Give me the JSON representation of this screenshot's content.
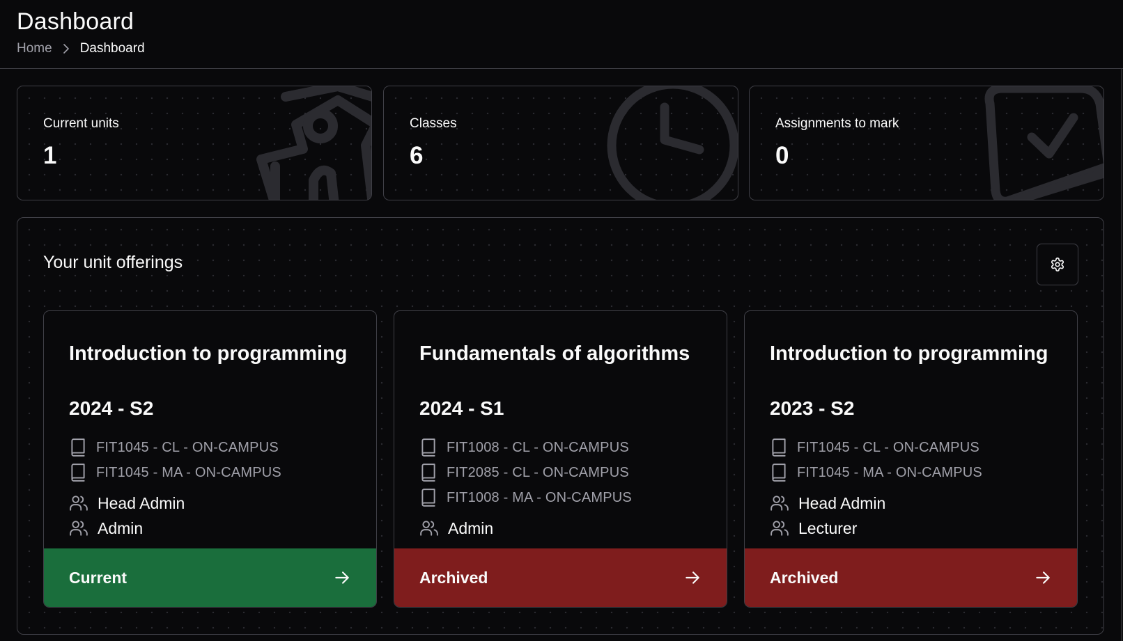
{
  "header": {
    "title": "Dashboard",
    "breadcrumb": {
      "home": "Home",
      "current": "Dashboard"
    }
  },
  "stats": [
    {
      "label": "Current units",
      "value": "1",
      "icon": "school-icon"
    },
    {
      "label": "Classes",
      "value": "6",
      "icon": "clock-icon"
    },
    {
      "label": "Assignments to mark",
      "value": "0",
      "icon": "clipboard-check-icon"
    }
  ],
  "offerings": {
    "title": "Your unit offerings",
    "settings_icon": "gear-icon",
    "cards": [
      {
        "name": "Introduction to programming",
        "term": "2024 - S2",
        "classes": [
          "FIT1045 - CL - ON-CAMPUS",
          "FIT1045 - MA - ON-CAMPUS"
        ],
        "roles": [
          "Head Admin",
          "Admin"
        ],
        "status": "Current",
        "status_color": "#1a6e3c"
      },
      {
        "name": "Fundamentals of algorithms",
        "term": "2024 - S1",
        "classes": [
          "FIT1008 - CL - ON-CAMPUS",
          "FIT2085 - CL - ON-CAMPUS",
          "FIT1008 - MA - ON-CAMPUS"
        ],
        "roles": [
          "Admin"
        ],
        "status": "Archived",
        "status_color": "#7f1d1d"
      },
      {
        "name": "Introduction to programming",
        "term": "2023 - S2",
        "classes": [
          "FIT1045 - CL - ON-CAMPUS",
          "FIT1045 - MA - ON-CAMPUS"
        ],
        "roles": [
          "Head Admin",
          "Lecturer"
        ],
        "status": "Archived",
        "status_color": "#7f1d1d"
      }
    ]
  },
  "colors": {
    "background": "#09090b",
    "border": "#3f3f46",
    "muted_text": "#a1a1aa",
    "current": "#1a6e3c",
    "archived": "#7f1d1d"
  }
}
